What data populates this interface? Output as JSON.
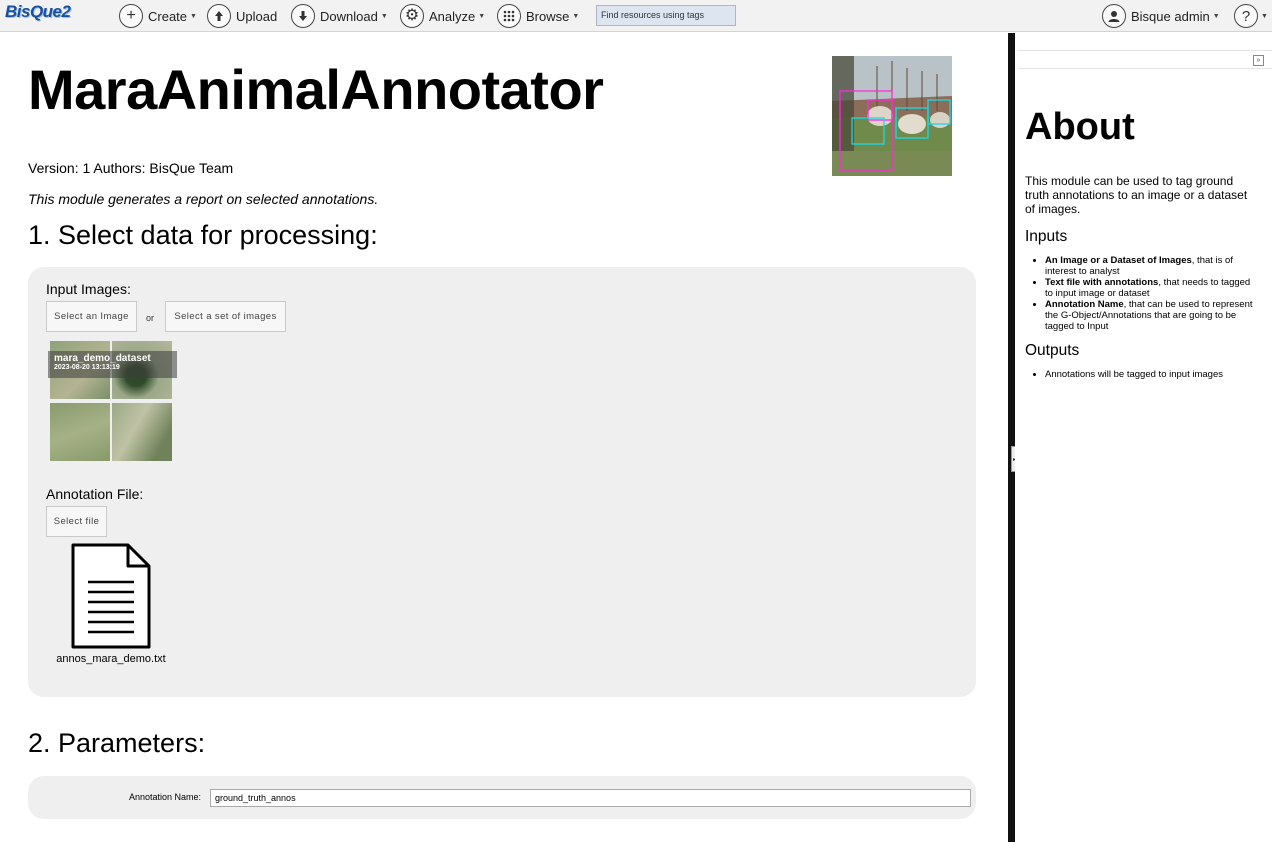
{
  "nav": {
    "logo": "BisQue2",
    "create": "Create",
    "upload": "Upload",
    "download": "Download",
    "analyze": "Analyze",
    "browse": "Browse",
    "search_placeholder": "Find resources using tags",
    "user": "Bisque admin",
    "help": "?"
  },
  "module": {
    "title": "MaraAnimalAnnotator",
    "meta": "Version: 1 Authors: BisQue Team",
    "description": "This module generates a report on selected annotations."
  },
  "section1": {
    "heading": "1. Select data for processing:",
    "input_images_label": "Input Images:",
    "select_image_btn": "Select an Image",
    "or_text": "or",
    "select_set_btn": "Select a set of images",
    "dataset": {
      "name": "mara_demo_dataset",
      "date": "2023-08-20 13:13:19"
    },
    "annotation_label": "Annotation File:",
    "select_file_btn": "Select file",
    "file_name": "annos_mara_demo.txt"
  },
  "section2": {
    "heading": "2. Parameters:",
    "annotation_name_label": "Annotation Name:",
    "annotation_name_value": "ground_truth_annos"
  },
  "about": {
    "heading": "About",
    "text": "This module can be used to tag ground truth annotations to an image or a dataset of images.",
    "inputs_heading": "Inputs",
    "inputs": [
      {
        "bold": "An Image or a Dataset of Images",
        "rest": ", that is of interest to analyst"
      },
      {
        "bold": "Text file with annotations",
        "rest": ", that needs to tagged to input image or dataset"
      },
      {
        "bold": "Annotation Name",
        "rest": ", that can be used to represent the G-Object/Annotations that are going to be tagged to Input"
      }
    ],
    "outputs_heading": "Outputs",
    "outputs": [
      "Annotations will be tagged to input images"
    ]
  },
  "icons": {
    "create": "plus-circle-icon",
    "upload": "upload-icon",
    "download": "download-icon",
    "analyze": "gears-icon",
    "browse": "grid-icon",
    "user": "user-icon",
    "help": "help-icon",
    "file": "text-file-icon",
    "collapse": "double-chevron-right-icon"
  },
  "colors": {
    "logo": "#1a4f9c",
    "panel_bg": "#efefef",
    "search_bg": "#dde5f0",
    "divider": "#111111"
  }
}
